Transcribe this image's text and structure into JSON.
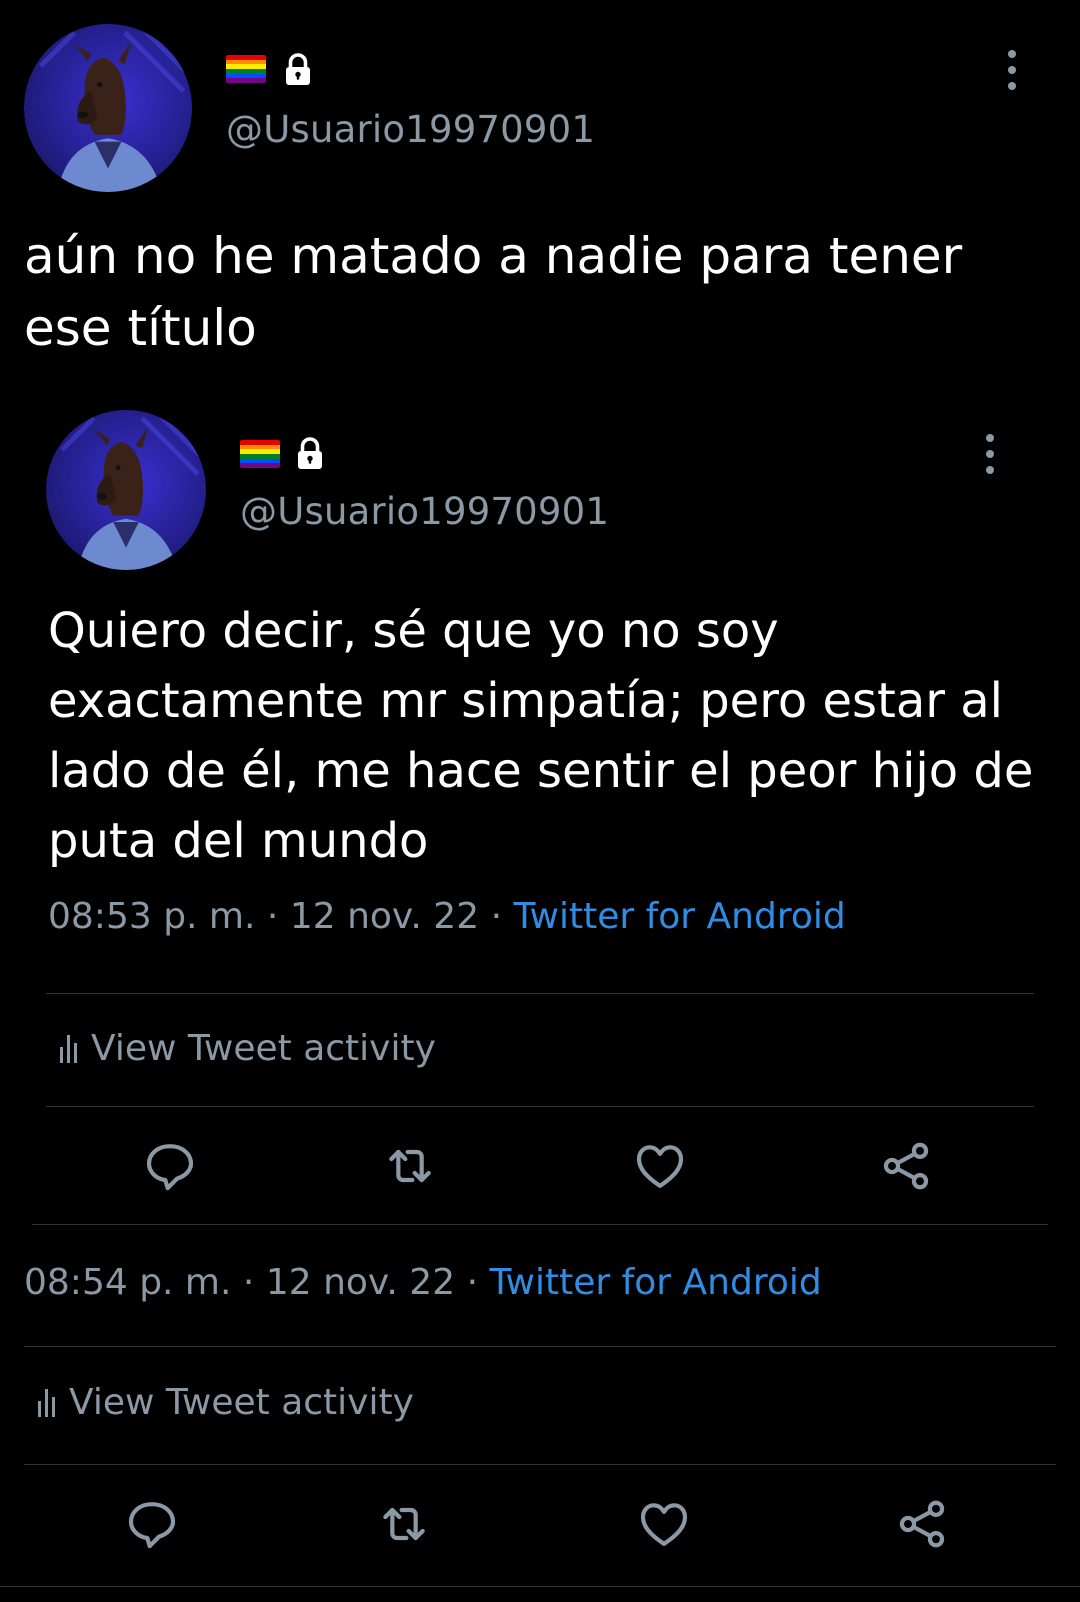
{
  "main_tweet": {
    "handle": "@Usuario19970901",
    "text": "aún no he matado a nadie para tener ese título",
    "meta": {
      "time": "08:54 p. m.",
      "separator": "·",
      "date": "12 nov. 22",
      "source": "Twitter for Android"
    },
    "activity_label": "View Tweet activity"
  },
  "quoted_tweet": {
    "handle": "@Usuario19970901",
    "text": "Quiero decir, sé que yo no soy exactamente mr simpatía; pero estar al lado de él, me hace sentir el peor hijo de puta del mundo",
    "meta": {
      "time": "08:53 p. m.",
      "separator": "·",
      "date": "12 nov. 22",
      "source": "Twitter for Android"
    },
    "activity_label": "View Tweet activity"
  },
  "icons": {
    "flag": "rainbow-flag-icon",
    "lock": "lock-icon",
    "more": "more-options-icon",
    "reply": "reply-icon",
    "retweet": "retweet-icon",
    "like": "like-icon",
    "share": "share-icon",
    "activity": "activity-icon"
  },
  "colors": {
    "background": "#000000",
    "text": "#ffffff",
    "secondary": "#8b98a5",
    "link": "#2f8de4",
    "divider": "#2f3336"
  }
}
